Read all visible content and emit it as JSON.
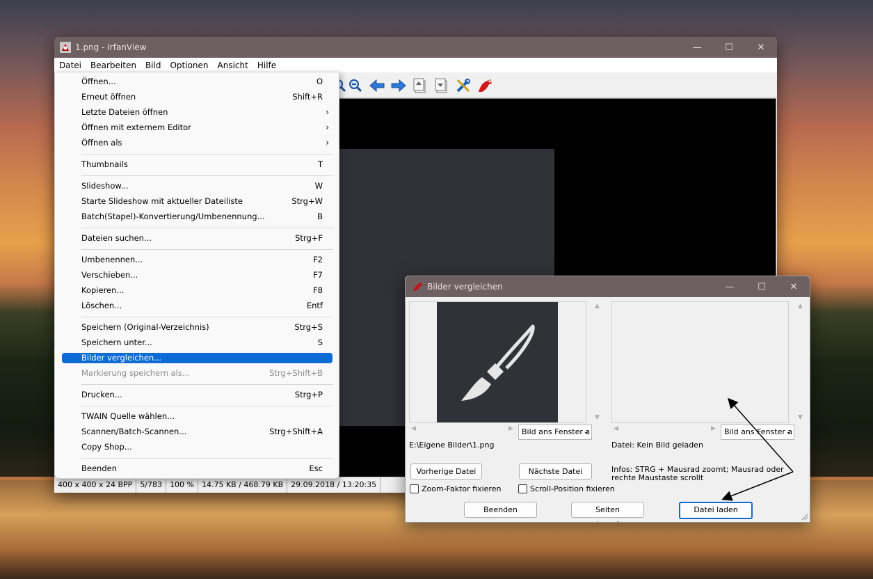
{
  "desktop": {
    "wallpaper": "sunset-lake"
  },
  "main_window": {
    "title": "1.png - IrfanView",
    "caption": {
      "minimize": "—",
      "maximize": "☐",
      "close": "✕"
    },
    "menubar": [
      "Datei",
      "Bearbeiten",
      "Bild",
      "Optionen",
      "Ansicht",
      "Hilfe"
    ],
    "toolbar_icons": [
      "zoom-in-icon",
      "zoom-out-icon",
      "arrow-left-icon",
      "arrow-right-icon",
      "page-up-icon",
      "page-down-icon",
      "tools-icon",
      "irfanview-logo-icon"
    ],
    "status": [
      "400 x 400 x 24 BPP",
      "5/783",
      "100 %",
      "14.75 KB / 468.79 KB",
      "29.09.2018 / 13:20:35"
    ]
  },
  "datei_menu": {
    "items": [
      {
        "label": "Öffnen...",
        "shortcut": "O"
      },
      {
        "label": "Erneut öffnen",
        "shortcut": "Shift+R"
      },
      {
        "label": "Letzte Dateien öffnen",
        "submenu": "›"
      },
      {
        "label": "Öffnen mit externem Editor",
        "submenu": "›"
      },
      {
        "label": "Öffnen als",
        "submenu": "›"
      },
      {
        "label": "Thumbnails",
        "shortcut": "T"
      },
      {
        "label": "Slideshow...",
        "shortcut": "W"
      },
      {
        "label": "Starte Slideshow mit aktueller Dateiliste",
        "shortcut": "Strg+W"
      },
      {
        "label": "Batch(Stapel)-Konvertierung/Umbenennung...",
        "shortcut": "B"
      },
      {
        "label": "Dateien suchen...",
        "shortcut": "Strg+F"
      },
      {
        "label": "Umbenennen...",
        "shortcut": "F2"
      },
      {
        "label": "Verschieben...",
        "shortcut": "F7"
      },
      {
        "label": "Kopieren...",
        "shortcut": "F8"
      },
      {
        "label": "Löschen...",
        "shortcut": "Entf"
      },
      {
        "label": "Speichern (Original-Verzeichnis)",
        "shortcut": "Strg+S"
      },
      {
        "label": "Speichern unter...",
        "shortcut": "S"
      },
      {
        "label": "Bilder vergleichen...",
        "shortcut": ""
      },
      {
        "label": "Markierung speichern als...",
        "shortcut": "Strg+Shift+B"
      },
      {
        "label": "Drucken...",
        "shortcut": "Strg+P"
      },
      {
        "label": "TWAIN Quelle wählen...",
        "shortcut": ""
      },
      {
        "label": "Scannen/Batch-Scannen...",
        "shortcut": "Strg+Shift+A"
      },
      {
        "label": "Copy Shop...",
        "shortcut": ""
      },
      {
        "label": "Beenden",
        "shortcut": "Esc"
      }
    ]
  },
  "compare_dialog": {
    "title": "Bilder vergleichen",
    "caption": {
      "minimize": "—",
      "maximize": "☐",
      "close": "✕"
    },
    "left": {
      "fit_option": "Bild ans Fenster a",
      "file": "E:\\Eigene Bilder\\1.png"
    },
    "right": {
      "fit_option": "Bild ans Fenster a",
      "file": "Datei: Kein Bild geladen"
    },
    "info": "Infos: STRG + Mausrad zoomt; Mausrad oder rechte Maustaste scrollt",
    "buttons": {
      "prev": "Vorherige Datei",
      "next": "Nächste Datei",
      "quit": "Beenden",
      "swap": "Seiten vertauschen",
      "load": "Datei laden"
    },
    "checkboxes": {
      "zoom": "Zoom-Faktor fixieren",
      "scroll": "Scroll-Position fixieren"
    }
  }
}
